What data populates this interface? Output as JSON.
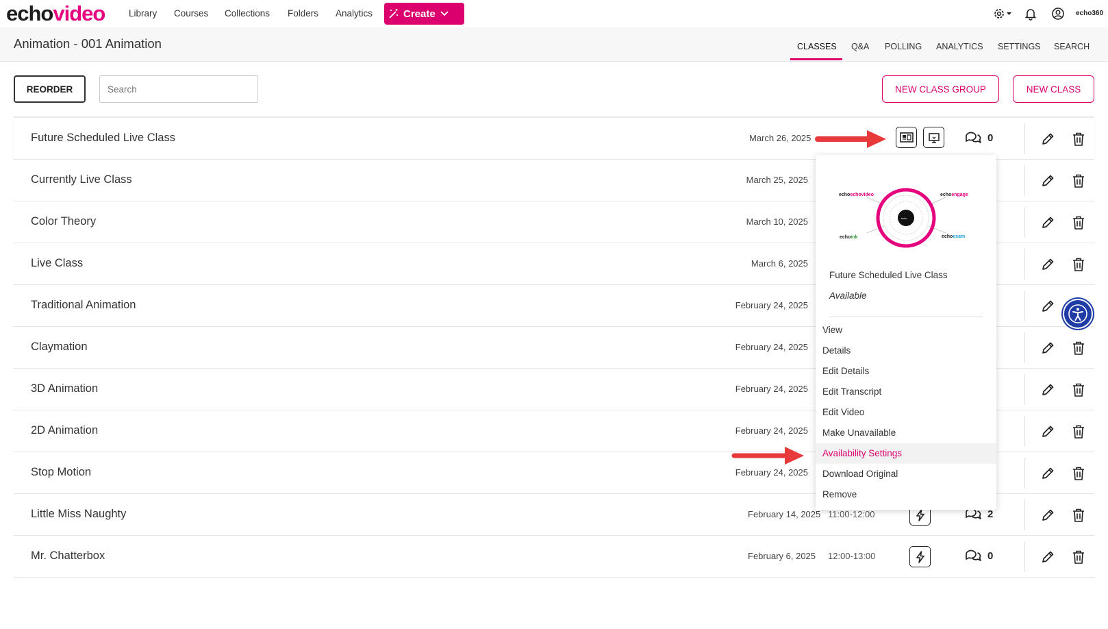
{
  "brand": {
    "logo_part1": "echo",
    "logo_part2": "video",
    "small_logo": "echo360"
  },
  "nav": [
    "Library",
    "Courses",
    "Collections",
    "Folders",
    "Analytics"
  ],
  "create_label": "Create",
  "page_title": "Animation - 001 Animation",
  "tabs": [
    "CLASSES",
    "Q&A",
    "POLLING",
    "ANALYTICS",
    "SETTINGS",
    "SEARCH"
  ],
  "active_tab": "CLASSES",
  "toolbar": {
    "reorder_label": "REORDER",
    "search_placeholder": "Search",
    "new_class_group_label": "NEW CLASS GROUP",
    "new_class_label": "NEW CLASS"
  },
  "classes": [
    {
      "title": "Future Scheduled Live Class",
      "date": "March 26, 2025",
      "time": "",
      "chat_count": "0"
    },
    {
      "title": "Currently Live Class",
      "date": "March 25, 2025",
      "time": "",
      "chat_count": ""
    },
    {
      "title": "Color Theory",
      "date": "March 10, 2025",
      "time": "",
      "chat_count": ""
    },
    {
      "title": "Live Class",
      "date": "March 6, 2025",
      "time": "",
      "chat_count": ""
    },
    {
      "title": "Traditional Animation",
      "date": "February 24, 2025",
      "time": "",
      "chat_count": ""
    },
    {
      "title": "Claymation",
      "date": "February 24, 2025",
      "time": "",
      "chat_count": ""
    },
    {
      "title": "3D Animation",
      "date": "February 24, 2025",
      "time": "",
      "chat_count": ""
    },
    {
      "title": "2D Animation",
      "date": "February 24, 2025",
      "time": "",
      "chat_count": ""
    },
    {
      "title": "Stop Motion",
      "date": "February 24, 2025",
      "time": "",
      "chat_count": ""
    },
    {
      "title": "Little Miss Naughty",
      "date": "February 14, 2025",
      "time": "11:00-12:00",
      "chat_count": "2"
    },
    {
      "title": "Mr. Chatterbox",
      "date": "February 6, 2025",
      "time": "12:00-13:00",
      "chat_count": "0"
    }
  ],
  "dropdown": {
    "class_title": "Future Scheduled Live Class",
    "status": "Available",
    "thumbnail_labels": {
      "echovideo": "echovideo",
      "echoengage": "echoengage",
      "echoink": "echoink",
      "echoexam": "echoexam"
    },
    "items": [
      "View",
      "Details",
      "Edit Details",
      "Edit Transcript",
      "Edit Video",
      "Make Unavailable",
      "Availability Settings",
      "Download Original",
      "Remove"
    ],
    "highlighted_item": "Availability Settings"
  },
  "colors": {
    "accent": "#dc006f",
    "arrow": "#e83a3a",
    "a11y": "#1f3ca6"
  },
  "icons": [
    "settings-icon",
    "bell-icon",
    "user-icon",
    "media-icon",
    "presentation-icon",
    "chat-icon",
    "lightning-icon",
    "edit-icon",
    "trash-icon",
    "accessibility-icon"
  ]
}
